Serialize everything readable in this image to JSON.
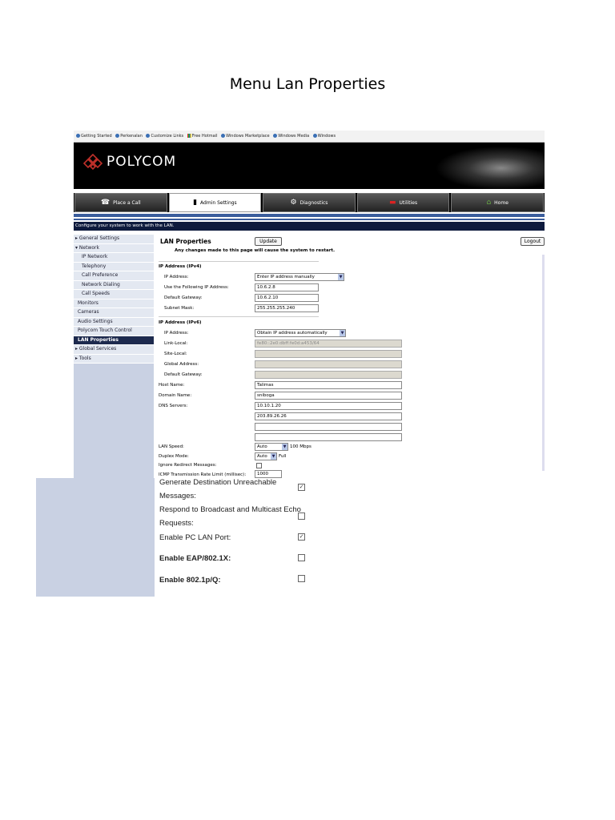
{
  "document": {
    "title": "Menu Lan  Properties"
  },
  "favorites_bar": [
    "Getting Started",
    "Perkenalan",
    "Customize Links",
    "Free Hotmail",
    "Windows Marketplace",
    "Windows Media",
    "Windows"
  ],
  "brand": {
    "name": "POLYCOM"
  },
  "nav_tabs": [
    "Place a Call",
    "Admin Settings",
    "Diagnostics",
    "Utilities",
    "Home"
  ],
  "config_message": "Configure your system to work with the LAN.",
  "sidebar": {
    "items": [
      "General Settings",
      "Network",
      "IP Network",
      "Telephony",
      "Call Preference",
      "Network Dialing",
      "Call Speeds",
      "Monitors",
      "Cameras",
      "Audio Settings",
      "Polycom Touch Control",
      "LAN Properties",
      "Global Services",
      "Tools"
    ]
  },
  "page": {
    "title": "LAN Properties",
    "update_label": "Update",
    "logout_label": "Logout",
    "warning": "Any changes made to this page will cause the system to restart."
  },
  "ipv4": {
    "section": "IP Address (IPv4)",
    "ip_label": "IP Address:",
    "ip_mode": "Enter IP address manually",
    "use_ip_label": "Use the Following IP Address:",
    "use_ip_value": "10.6.2.8",
    "gateway_label": "Default Gateway:",
    "gateway_value": "10.6.2.10",
    "mask_label": "Subnet Mask:",
    "mask_value": "255.255.255.240"
  },
  "ipv6": {
    "section": "IP Address (IPv6)",
    "ip_label": "IP Address:",
    "ip_mode": "Obtain IP address automatically",
    "link_local_label": "Link-Local:",
    "link_local_value": "fe80::2e0:dbff:fe0d:a453/64",
    "site_local_label": "Site-Local:",
    "global_label": "Global Address:",
    "gateway_label": "Default Gateway:"
  },
  "host": {
    "label": "Host Name:",
    "value": "Talimas"
  },
  "domain": {
    "label": "Domain Name:",
    "value": "sniboga"
  },
  "dns": {
    "label": "DNS Servers:",
    "server1": "10.10.1.20",
    "server2": "203.89.26.26"
  },
  "lan_speed": {
    "label": "LAN Speed:",
    "value": "Auto",
    "actual": "100 Mbps"
  },
  "duplex": {
    "label": "Duplex Mode:",
    "value": "Auto",
    "actual": "Full"
  },
  "ignore_redirect": {
    "label": "Ignore Redirect Messages:"
  },
  "icmp": {
    "label": "ICMP Transmission Rate Limit (millisec):",
    "value": "1000"
  },
  "lower": {
    "gen_dest_line1": "Generate Destination Unreachable",
    "gen_dest_line2": "Messages:",
    "respond_line1": "Respond to Broadcast and Multicast Echo",
    "respond_line2": "Requests:",
    "enable_pc_lan": "Enable PC LAN Port:",
    "enable_eap": "Enable EAP/802.1X:",
    "enable_8021p": "Enable 802.1p/Q:",
    "checked_mark": "✓"
  }
}
